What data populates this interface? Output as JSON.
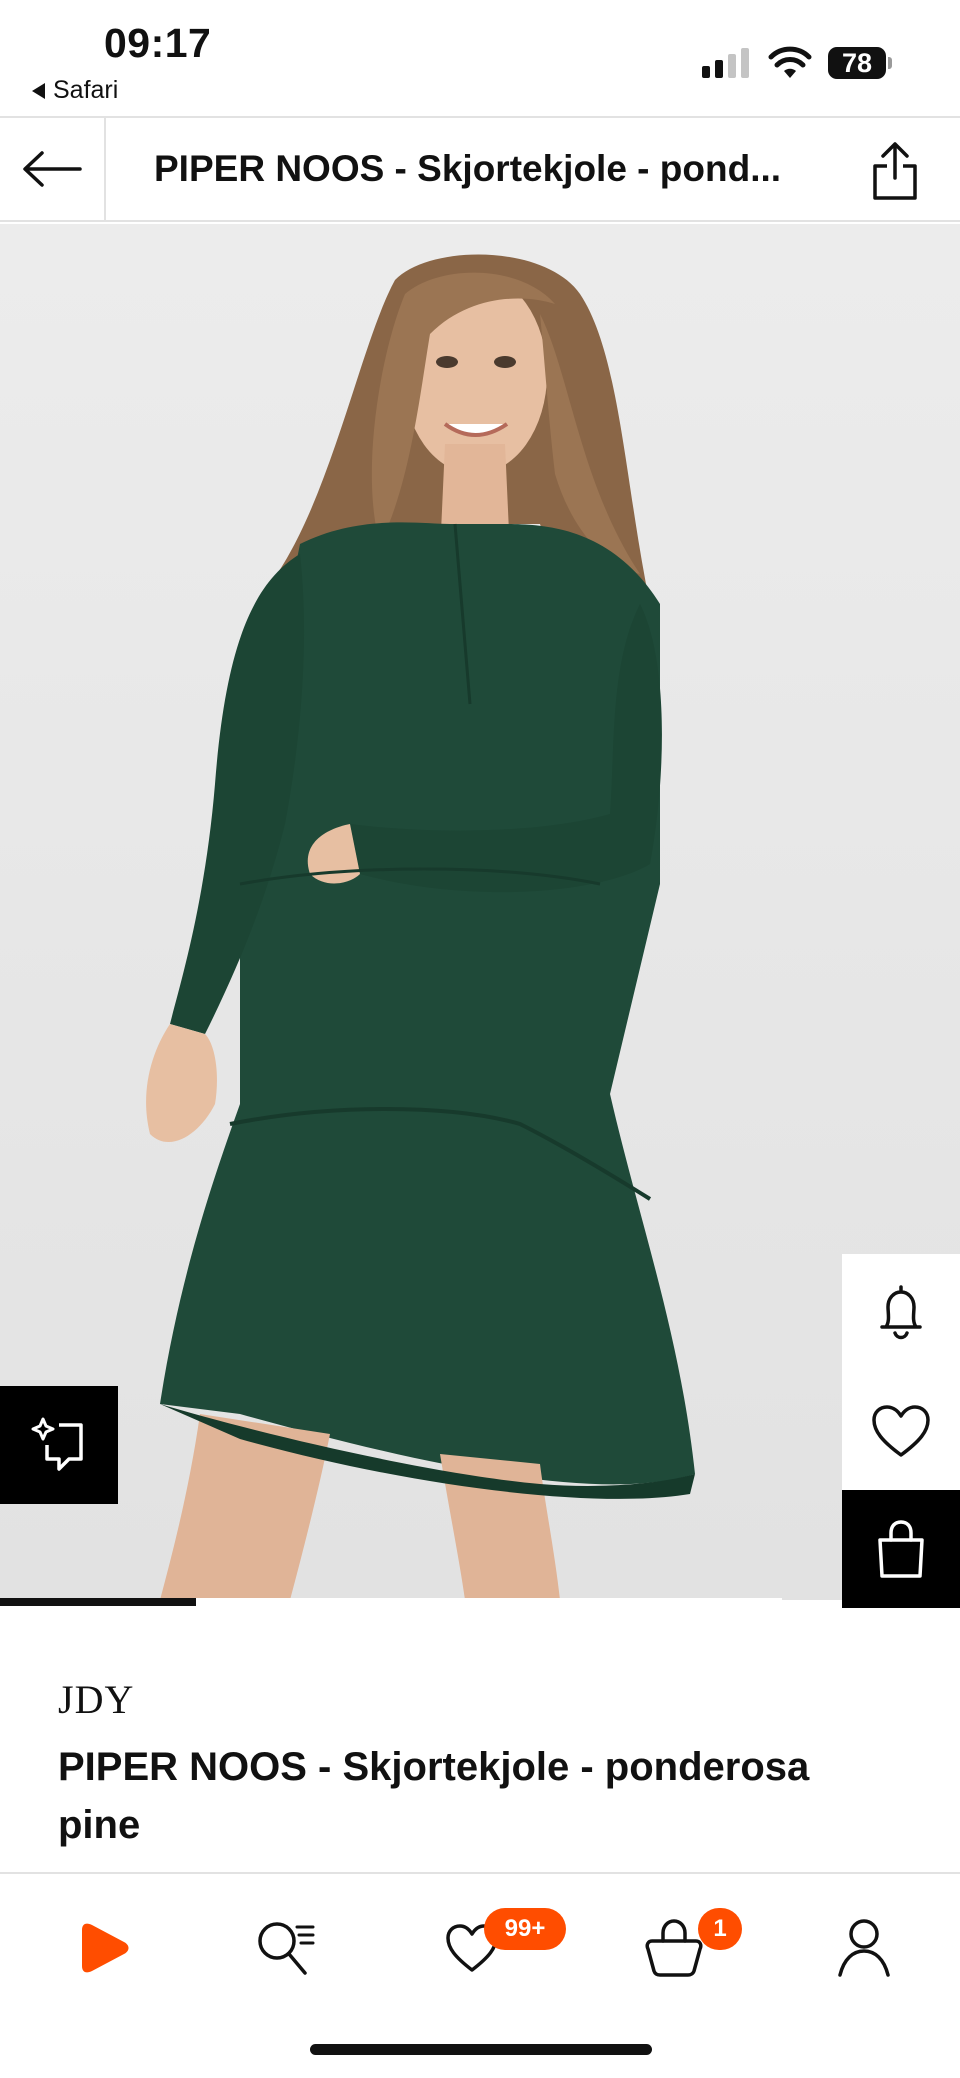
{
  "status_bar": {
    "time": "09:17",
    "back_app": "Safari",
    "battery": "78"
  },
  "top_nav": {
    "title": "PIPER NOOS - Skjortekjole - pond..."
  },
  "gallery": {
    "progress_fraction": 0.25,
    "image_alt": "Model wearing dark green shirt dress"
  },
  "product": {
    "brand": "JDY",
    "title": "PIPER NOOS - Skjortekjole - ponderosa pine"
  },
  "tab_bar": {
    "wishlist_badge": "99+",
    "bag_badge": "1"
  },
  "colors": {
    "accent": "#ff4d00",
    "dress": "#1f4a39"
  }
}
